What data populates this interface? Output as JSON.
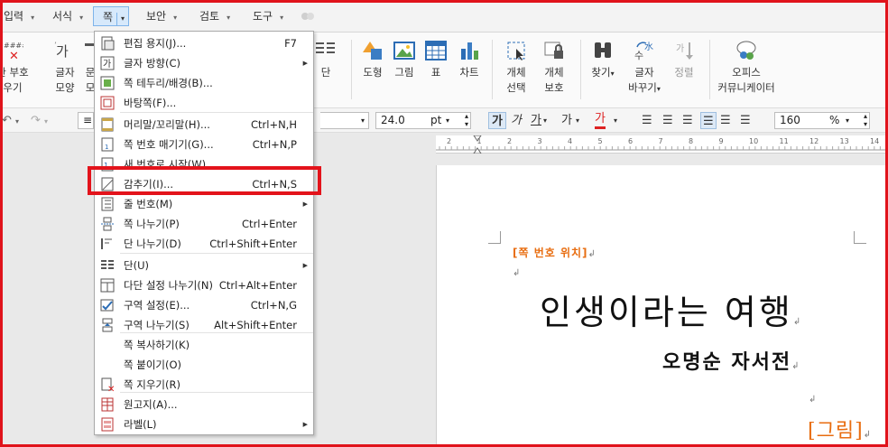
{
  "menubar": {
    "items": [
      {
        "label": "입력"
      },
      {
        "label": "서식"
      },
      {
        "label": "쪽"
      },
      {
        "label": "보안"
      },
      {
        "label": "검토"
      },
      {
        "label": "도구"
      }
    ]
  },
  "ribbon": {
    "left_partial": [
      "한 부호",
      "우기"
    ],
    "char_shape": [
      "글자",
      "모양"
    ],
    "para_partial": [
      "문",
      "모"
    ],
    "columns": "단",
    "shape": "도형",
    "picture": "그림",
    "table": "표",
    "chart": "차트",
    "obj_select": [
      "개체",
      "선택"
    ],
    "obj_protect": [
      "개체",
      "보호"
    ],
    "find": "찾기",
    "replace": [
      "글자",
      "바꾸기"
    ],
    "correct": "정렬",
    "office": [
      "오피스",
      "커뮤니케이터"
    ]
  },
  "format": {
    "font_size": "24.0",
    "unit": "pt",
    "bold": "가",
    "italic": "가",
    "underline": "가",
    "strike": "가",
    "color": "가",
    "zoom": "160",
    "zoom_unit": "%"
  },
  "ruler": {
    "numbers": [
      "2",
      "1",
      "2",
      "3",
      "4",
      "5",
      "6",
      "7",
      "8",
      "9",
      "10",
      "11",
      "12",
      "13",
      "14"
    ]
  },
  "document": {
    "label": "[쪽 번호 위치]",
    "title": "인생이라는 여행",
    "subtitle": "오명순 자서전",
    "figure": "[그림]"
  },
  "dropdown": {
    "items": [
      {
        "label": "편집 용지(J)...",
        "shortcut": "F7",
        "icon": "page-setup-icon"
      },
      {
        "label": "글자 방향(C)",
        "shortcut": "",
        "submenu": true,
        "icon": "text-direction-icon"
      },
      {
        "label": "쪽 테두리/배경(B)...",
        "shortcut": "",
        "icon": "page-border-icon"
      },
      {
        "label": "바탕쪽(F)...",
        "shortcut": "",
        "icon": "master-page-icon"
      },
      {
        "label": "머리말/꼬리말(H)...",
        "shortcut": "Ctrl+N,H",
        "icon": "header-footer-icon"
      },
      {
        "label": "쪽 번호 매기기(G)...",
        "shortcut": "Ctrl+N,P",
        "icon": "page-number-icon"
      },
      {
        "label": "새 번호로 시작(W)...",
        "shortcut": "",
        "icon": "new-number-icon"
      },
      {
        "label": "감추기(I)...",
        "shortcut": "Ctrl+N,S",
        "icon": "hide-icon"
      },
      {
        "label": "줄 번호(M)",
        "shortcut": "",
        "submenu": true,
        "icon": "line-number-icon"
      },
      {
        "label": "쪽 나누기(P)",
        "shortcut": "Ctrl+Enter",
        "icon": "page-break-icon"
      },
      {
        "label": "단 나누기(D)",
        "shortcut": "Ctrl+Shift+Enter",
        "icon": "column-break-icon"
      },
      {
        "label": "단(U)",
        "shortcut": "",
        "submenu": true,
        "icon": "columns-icon"
      },
      {
        "label": "다단 설정 나누기(N)",
        "shortcut": "Ctrl+Alt+Enter",
        "icon": "multi-column-icon"
      },
      {
        "label": "구역 설정(E)...",
        "shortcut": "Ctrl+N,G",
        "icon": "section-setup-icon"
      },
      {
        "label": "구역 나누기(S)",
        "shortcut": "Alt+Shift+Enter",
        "icon": "section-break-icon"
      },
      {
        "label": "쪽 복사하기(K)",
        "shortcut": "",
        "icon": ""
      },
      {
        "label": "쪽 붙이기(O)",
        "shortcut": "",
        "icon": ""
      },
      {
        "label": "쪽 지우기(R)",
        "shortcut": "",
        "icon": "delete-page-icon"
      },
      {
        "label": "원고지(A)...",
        "shortcut": "",
        "icon": "manuscript-icon"
      },
      {
        "label": "라벨(L)",
        "shortcut": "",
        "submenu": true,
        "icon": "label-icon"
      }
    ]
  },
  "colors": {
    "highlight": "#e3131b",
    "accent": "#e86d10",
    "menu_active": "#d7e9fb"
  }
}
